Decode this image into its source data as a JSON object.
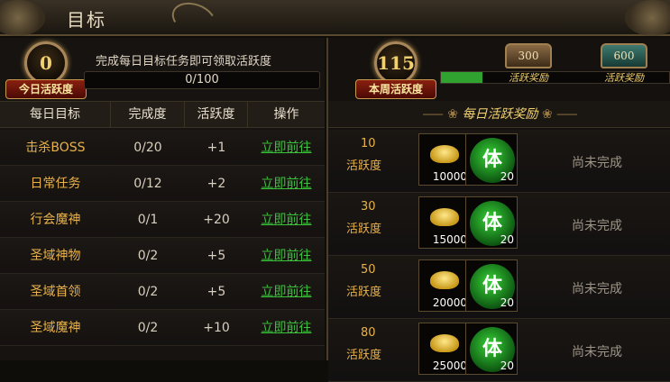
{
  "window": {
    "title": "目标"
  },
  "daily": {
    "score": "0",
    "label": "今日活跃度",
    "description": "完成每日目标任务即可领取活跃度",
    "progress_text": "0/100",
    "progress_fraction": 0
  },
  "weekly": {
    "score": "115",
    "label": "本周活跃度",
    "progress_fraction": 0.18,
    "chests": [
      {
        "value": "300",
        "label": "活跃奖励"
      },
      {
        "value": "600",
        "label": "活跃奖励"
      }
    ]
  },
  "table": {
    "headers": [
      "每日目标",
      "完成度",
      "活跃度",
      "操作"
    ],
    "rows": [
      {
        "name": "击杀BOSS",
        "progress": "0/20",
        "points": "+1",
        "action": "立即前往"
      },
      {
        "name": "日常任务",
        "progress": "0/12",
        "points": "+2",
        "action": "立即前往"
      },
      {
        "name": "行会魔神",
        "progress": "0/1",
        "points": "+20",
        "action": "立即前往"
      },
      {
        "name": "圣域神物",
        "progress": "0/2",
        "points": "+5",
        "action": "立即前往"
      },
      {
        "name": "圣域首领",
        "progress": "0/2",
        "points": "+5",
        "action": "立即前往"
      },
      {
        "name": "圣域魔神",
        "progress": "0/2",
        "points": "+10",
        "action": "立即前往"
      }
    ]
  },
  "rewards": {
    "title": "每日活跃奖励",
    "points_label": "活跃度",
    "items": [
      {
        "points": "10",
        "gold": "10000",
        "orb_char": "体",
        "orb_qty": "20",
        "status": "尚未完成"
      },
      {
        "points": "30",
        "gold": "15000",
        "orb_char": "体",
        "orb_qty": "20",
        "status": "尚未完成"
      },
      {
        "points": "50",
        "gold": "20000",
        "orb_char": "体",
        "orb_qty": "20",
        "status": "尚未完成"
      },
      {
        "points": "80",
        "gold": "25000",
        "orb_char": "体",
        "orb_qty": "20",
        "status": "尚未完成"
      }
    ]
  },
  "colors": {
    "accent_gold": "#e9b24a",
    "link_green": "#39c239",
    "progress_green": "#2fa22f"
  }
}
